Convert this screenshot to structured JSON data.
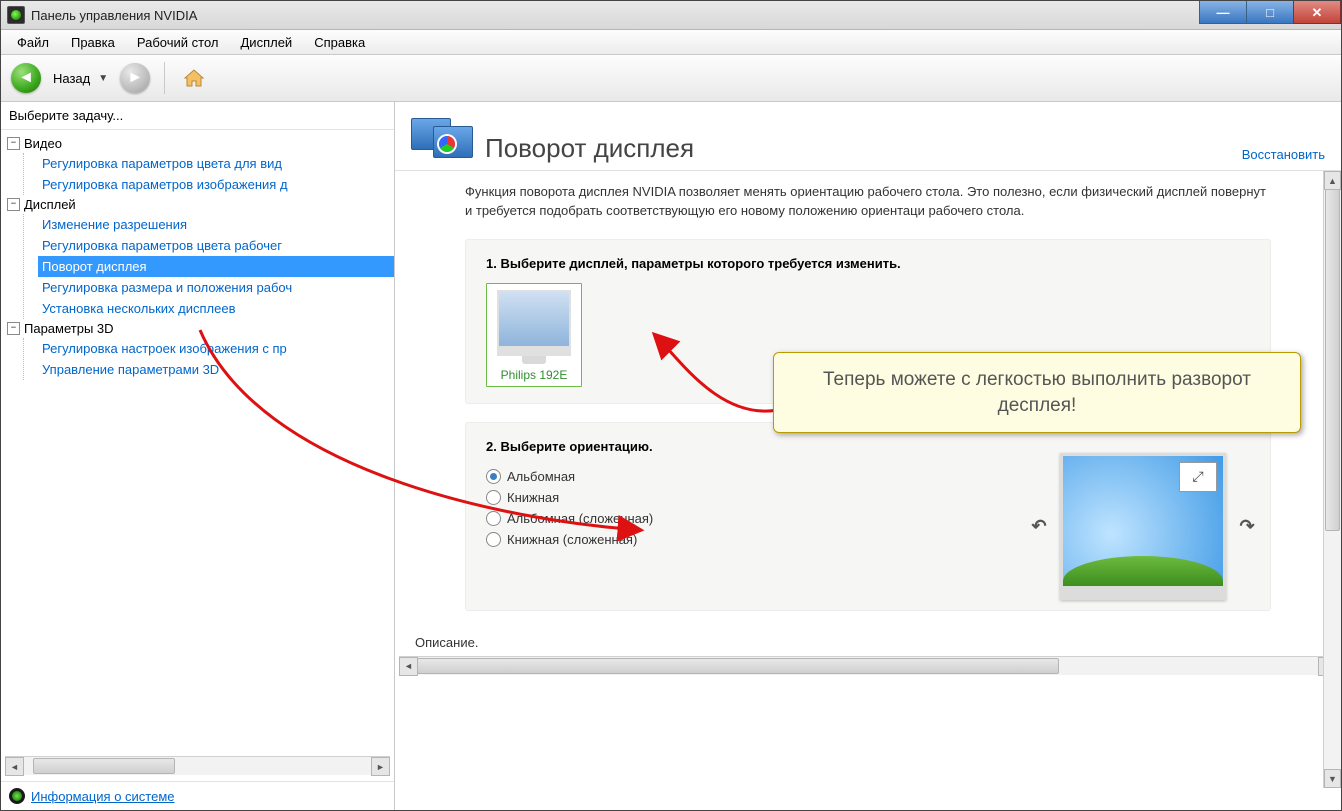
{
  "window": {
    "title": "Панель управления NVIDIA"
  },
  "menu": {
    "items": [
      "Файл",
      "Правка",
      "Рабочий стол",
      "Дисплей",
      "Справка"
    ]
  },
  "toolbar": {
    "back": "Назад"
  },
  "sidebar": {
    "header": "Выберите задачу...",
    "video": {
      "label": "Видео",
      "items": [
        "Регулировка параметров цвета для вид",
        "Регулировка параметров изображения д"
      ]
    },
    "display": {
      "label": "Дисплей",
      "items": [
        "Изменение разрешения",
        "Регулировка параметров цвета рабочег",
        "Поворот дисплея",
        "Регулировка размера и положения рабоч",
        "Установка нескольких дисплеев"
      ]
    },
    "params3d": {
      "label": "Параметры 3D",
      "items": [
        "Регулировка настроек изображения с пр",
        "Управление параметрами 3D"
      ]
    },
    "sysinfo": "Информация о системе"
  },
  "main": {
    "title": "Поворот дисплея",
    "restore": "Восстановить",
    "description": "Функция поворота дисплея NVIDIA позволяет менять ориентацию рабочего стола. Это полезно, если физический дисплей повернут и требуется подобрать соответствующую его новому положению ориентаци рабочего стола.",
    "step1": "1. Выберите дисплей, параметры которого требуется изменить.",
    "monitor": "Philips 192E",
    "step2": "2. Выберите ориентацию.",
    "orientations": [
      "Альбомная",
      "Книжная",
      "Альбомная (сложенная)",
      "Книжная (сложенная)"
    ],
    "selectedOrientation": 0,
    "footer": "Описание."
  },
  "callout": "Теперь можете с легкостью выполнить разворот десплея!"
}
